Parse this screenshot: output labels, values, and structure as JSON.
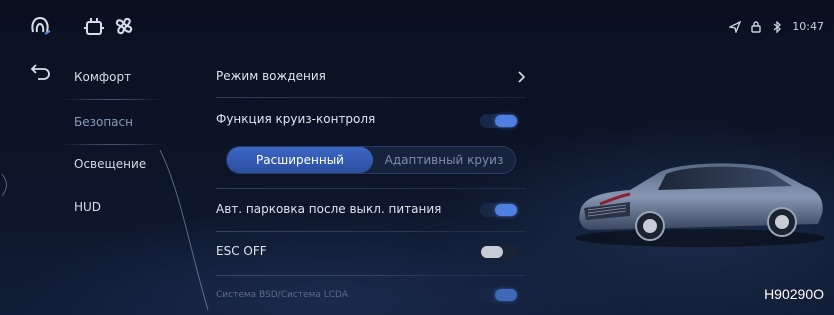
{
  "topbar": {
    "icons": [
      "headrest-seat-icon",
      "seat-massage-icon",
      "fan-icon"
    ]
  },
  "status": {
    "icons": [
      "location-arrow-icon",
      "lock-icon",
      "bluetooth-icon"
    ],
    "time": "10:47"
  },
  "nav": {
    "items": [
      {
        "label": "Комфорт",
        "active": false
      },
      {
        "label": "Безопасн",
        "active": true
      },
      {
        "label": "Освещение",
        "active": false
      },
      {
        "label": "HUD",
        "active": false
      }
    ]
  },
  "settings": {
    "drive_mode_label": "Режим вождения",
    "cruise_label": "Функция круиз-контроля",
    "cruise_on": true,
    "cruise_modes": [
      "Расширенный",
      "Адаптивный круиз"
    ],
    "cruise_mode_selected": "Расширенный",
    "auto_park_label": "Авт. парковка после выкл. питания",
    "auto_park_on": true,
    "esc_label": "ESC OFF",
    "esc_on": false,
    "partial_row_label": "Система BSD/Система LCDA",
    "partial_row_on": true
  },
  "colors": {
    "accent": "#4f7fe0",
    "background": "#0c1428",
    "text": "#dfe4ee"
  },
  "watermark": "H90290O"
}
